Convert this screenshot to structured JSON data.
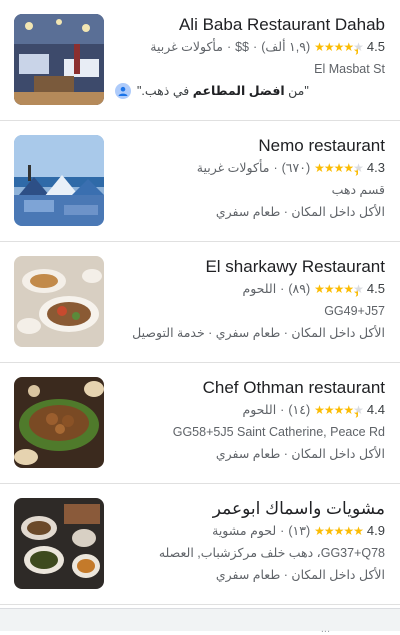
{
  "results": [
    {
      "name": "Ali Baba Restaurant Dahab",
      "rating": "4.5",
      "reviews": "(١,٩ ألف)",
      "price": "$$",
      "category": "مأكولات غربية",
      "address": "El Masbat St",
      "review_prefix": "\"من ",
      "review_bold": "افضل المطاعم",
      "review_suffix": " في ذهب.\""
    },
    {
      "name": "Nemo restaurant",
      "rating": "4.3",
      "reviews": "(٦٧٠)",
      "category": "مأكولات غربية",
      "address": "قسم دهب",
      "services": "الأكل داخل المكان · طعام سفري"
    },
    {
      "name": "El sharkawy Restaurant",
      "rating": "4.5",
      "reviews": "(٨٩)",
      "category": "اللحوم",
      "address": "GG49+J57",
      "services": "الأكل داخل المكان · طعام سفري · خدمة التوصيل"
    },
    {
      "name": "Chef Othman restaurant",
      "rating": "4.4",
      "reviews": "(١٤)",
      "category": "اللحوم",
      "address": "GG58+5J5 Saint Catherine, Peace Rd",
      "services": "الأكل داخل المكان · طعام سفري"
    },
    {
      "name": "مشويات واسماك ابوعمر",
      "rating": "4.9",
      "reviews": "(١٣)",
      "category": "لحوم مشوية",
      "address": "GG37+Q78، دهب خلف مركزشباب, العصله",
      "services": "الأكل داخل المكان · طعام سفري"
    }
  ],
  "footer_peek": "...",
  "colors": {
    "star": "#fbbc04",
    "text": "#202124",
    "muted": "#5f6368"
  }
}
